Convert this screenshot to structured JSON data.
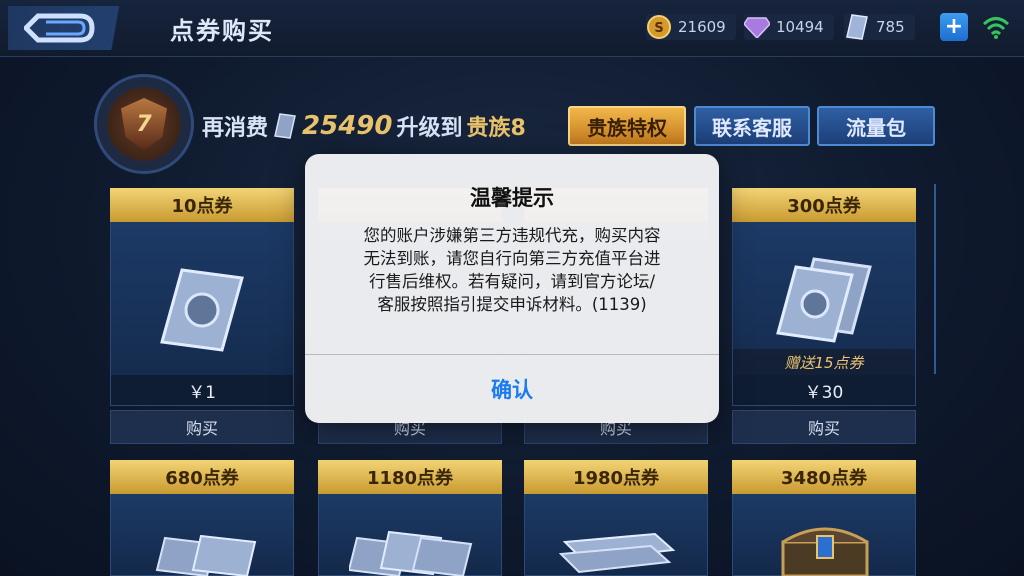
{
  "header": {
    "title": "点券购买",
    "currencies": [
      {
        "icon": "gold-coin-icon",
        "value": "21609",
        "color": "#d59a2c"
      },
      {
        "icon": "diamond-icon",
        "value": "10494",
        "color": "#a77be0"
      },
      {
        "icon": "coupon-icon",
        "value": "785",
        "color": "#9fb4d8"
      }
    ],
    "add_icon": "+"
  },
  "vip": {
    "rank_level": "7",
    "prefix": "再消费",
    "amount": "25490",
    "middle": "升级到",
    "target": "贵族8",
    "buttons": {
      "noble": "贵族特权",
      "service": "联系客服",
      "data": "流量包"
    }
  },
  "products": {
    "row1": [
      {
        "name": "10点券",
        "price": "￥1",
        "bonus": "",
        "buy": "购买"
      },
      {
        "name": "",
        "price": "",
        "bonus": "",
        "buy": "购买"
      },
      {
        "name": "",
        "price": "",
        "bonus": "",
        "buy": "购买"
      },
      {
        "name": "300点券",
        "price": "￥30",
        "bonus": "赠送15点券",
        "buy": "购买"
      }
    ],
    "row2": [
      {
        "name": "680点券"
      },
      {
        "name": "1180点券"
      },
      {
        "name": "1980点券"
      },
      {
        "name": "3480点券"
      }
    ]
  },
  "dialog": {
    "title": "温馨提示",
    "lines": [
      "您的账户涉嫌第三方违规代充，购买内容",
      "无法到账，请您自行向第三方充值平台进",
      "行售后维权。若有疑问，请到官方论坛/",
      "客服按照指引提交申诉材料。(1139)"
    ],
    "confirm": "确认"
  },
  "colors": {
    "accent_gold": "#e9c36b",
    "dialog_button": "#1a7cf0",
    "wifi": "#35c45a"
  }
}
